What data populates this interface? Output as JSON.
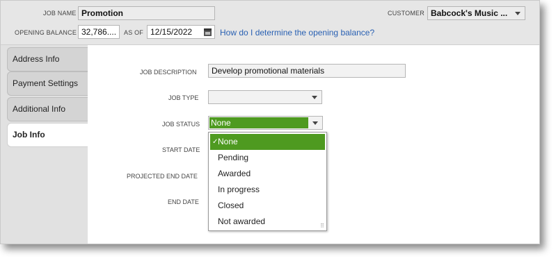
{
  "header": {
    "job_name_label": "JOB NAME",
    "job_name_value": "Promotion",
    "customer_label": "CUSTOMER",
    "customer_value": "Babcock's Music ...",
    "opening_balance_label": "OPENING BALANCE",
    "opening_balance_value": "32,786....",
    "as_of_label": "AS OF",
    "as_of_value": "12/15/2022",
    "help_link": "How do I determine the opening balance?"
  },
  "tabs": [
    {
      "label": "Address Info",
      "active": false
    },
    {
      "label": "Payment Settings",
      "active": false
    },
    {
      "label": "Additional Info",
      "active": false
    },
    {
      "label": "Job Info",
      "active": true
    }
  ],
  "form": {
    "job_description_label": "JOB DESCRIPTION",
    "job_description_value": "Develop promotional materials",
    "job_type_label": "JOB TYPE",
    "job_type_value": "",
    "job_status_label": "JOB STATUS",
    "job_status_value": "None",
    "start_date_label": "START DATE",
    "projected_end_date_label": "PROJECTED END DATE",
    "end_date_label": "END DATE"
  },
  "job_status_options": [
    "None",
    "Pending",
    "Awarded",
    "In progress",
    "Closed",
    "Not awarded"
  ],
  "selected_option": "None",
  "colors": {
    "accent_green": "#4e9a20",
    "link_blue": "#2a61b3"
  }
}
